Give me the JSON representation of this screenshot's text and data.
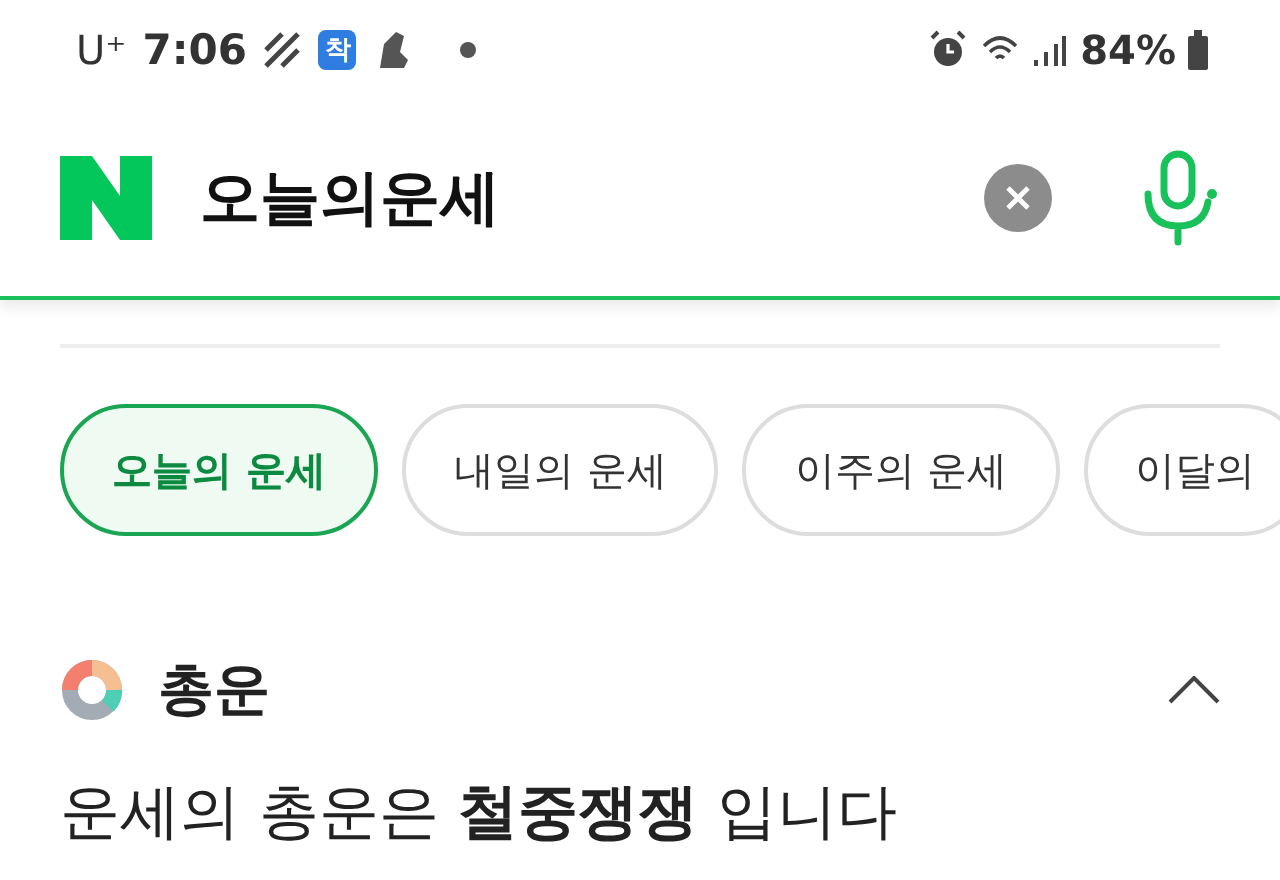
{
  "status_bar": {
    "carrier": "U⁺",
    "time": "7:06",
    "badge": "착",
    "battery": "84%"
  },
  "search": {
    "query": "오늘의운세"
  },
  "tabs": [
    {
      "label": "오늘의 운세",
      "selected": true
    },
    {
      "label": "내일의 운세",
      "selected": false
    },
    {
      "label": "이주의 운세",
      "selected": false
    },
    {
      "label": "이달의",
      "selected": false
    }
  ],
  "section": {
    "title": "총운",
    "expanded": true,
    "summary": "운세의 총운은 **철중쟁쟁** 입니다"
  }
}
